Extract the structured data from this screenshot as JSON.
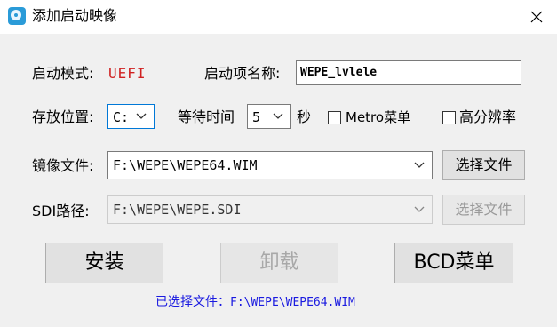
{
  "window": {
    "title": "添加启动映像",
    "close_icon": "close-icon",
    "app_icon": "disc-app-icon"
  },
  "boot_mode": {
    "label": "启动模式:",
    "value": "UEFI",
    "value_color": "#d02020"
  },
  "boot_name": {
    "label": "启动项名称:",
    "value": "WEPE_lvlele"
  },
  "placement": {
    "label": "存放位置:",
    "selected": "C:"
  },
  "wait_time": {
    "label": "等待时间",
    "selected": "5",
    "unit": "秒"
  },
  "options": {
    "metro_label": "Metro菜单",
    "metro_checked": false,
    "highres_label": "高分辨率",
    "highres_checked": false
  },
  "image_file": {
    "label": "镜像文件:",
    "value": "F:\\WEPE\\WEPE64.WIM",
    "browse_label": "选择文件"
  },
  "sdi_path": {
    "label": "SDI路径:",
    "value": "F:\\WEPE\\WEPE.SDI",
    "browse_label": "选择文件",
    "disabled": true
  },
  "actions": {
    "install_label": "安装",
    "uninstall_label": "卸载",
    "bcd_menu_label": "BCD菜单"
  },
  "status": {
    "prefix": "已选择文件：",
    "path": "F:\\WEPE\\WEPE64.WIM",
    "color": "#1a1ae0"
  }
}
